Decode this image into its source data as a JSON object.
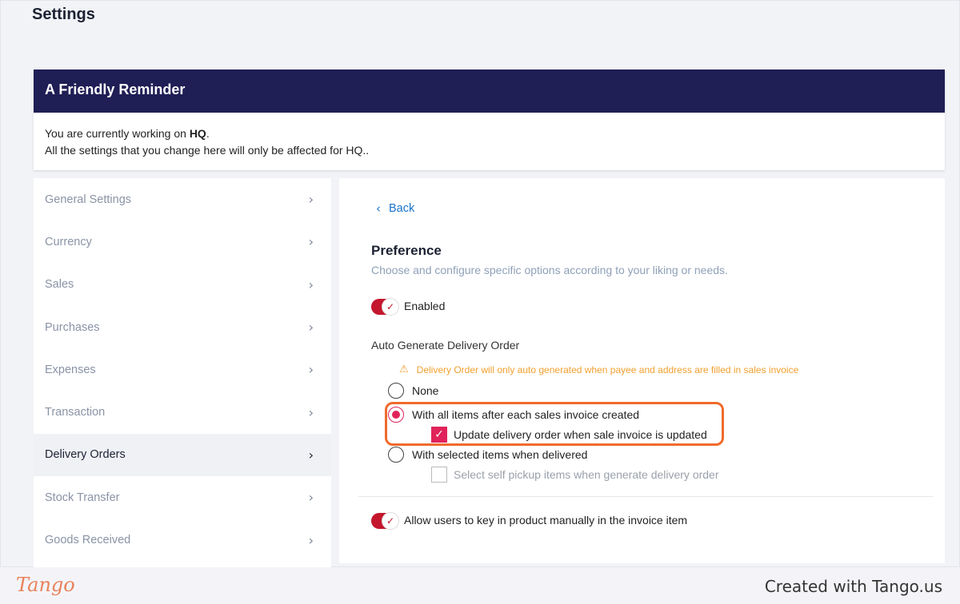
{
  "page": {
    "title": "Settings"
  },
  "reminder": {
    "title": "A Friendly Reminder",
    "line1_prefix": "You are currently working on ",
    "line1_bold": "HQ",
    "line1_suffix": ".",
    "line2": "All the settings that you change here will only be affected for HQ.."
  },
  "sidebar": {
    "items": [
      {
        "label": "General Settings"
      },
      {
        "label": "Currency"
      },
      {
        "label": "Sales"
      },
      {
        "label": "Purchases"
      },
      {
        "label": "Expenses"
      },
      {
        "label": "Transaction"
      },
      {
        "label": "Delivery Orders"
      },
      {
        "label": "Stock Transfer"
      },
      {
        "label": "Goods Received"
      }
    ],
    "active": "Delivery Orders",
    "chevron": "›"
  },
  "panel": {
    "back_label": "Back",
    "title": "Preference",
    "subtitle": "Choose and configure specific options according to your liking or needs.",
    "enabled_toggle": {
      "label": "Enabled",
      "on": true
    },
    "auto_generate": {
      "label": "Auto Generate Delivery Order",
      "warning": "Delivery Order will only auto generated when payee and address are filled in sales invoice",
      "options": [
        {
          "label": "None",
          "selected": false
        },
        {
          "label": "With all items after each sales invoice created",
          "selected": true
        },
        {
          "label": "With selected items when delivered",
          "selected": false
        }
      ],
      "sub_options": {
        "update_delivery": {
          "label": "Update delivery order when sale invoice is updated",
          "checked": true
        },
        "self_pickup": {
          "label": "Select self pickup items when generate delivery order",
          "checked": false
        }
      }
    },
    "manual_toggle": {
      "label": "Allow users to key in product manually in the invoice item",
      "on": true
    }
  },
  "footer": {
    "logo": "Tango",
    "created": "Created with Tango.us"
  },
  "colors": {
    "header_bg": "#1f1e55",
    "accent": "#e0235a",
    "toggle": "#c4162c",
    "link": "#1a73c9",
    "warning": "#f0a030",
    "highlight": "#f06a2c"
  }
}
